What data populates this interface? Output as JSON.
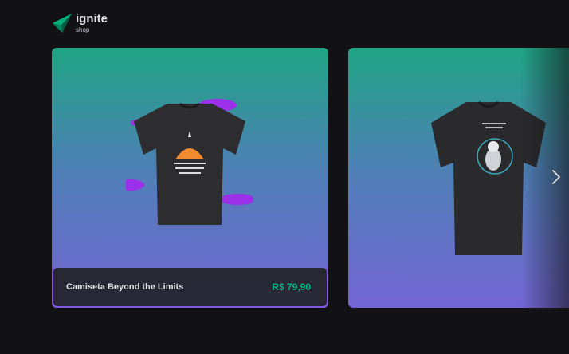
{
  "brand": {
    "title": "ignite",
    "subtitle": "shop",
    "accent": "#00875f"
  },
  "products": [
    {
      "name": "Camiseta Beyond the Limits",
      "price": "R$ 79,90"
    }
  ],
  "colors": {
    "background": "#121214",
    "price": "#00b37e",
    "gradient_top": "#1ea483",
    "gradient_bottom": "#7465d4",
    "focus_border": "#8257e5"
  },
  "icons": {
    "logo": "ignite-logo-icon",
    "next": "chevron-right-icon"
  }
}
